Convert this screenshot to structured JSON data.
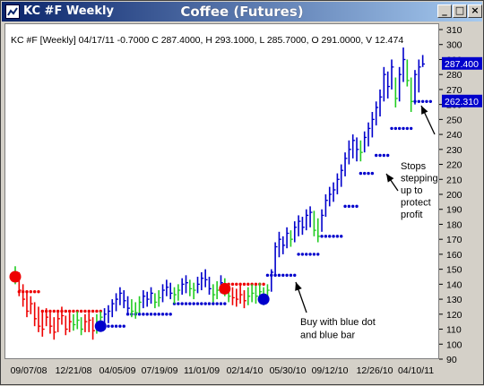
{
  "window": {
    "title_left": "KC #F Weekly",
    "title_center": "Coffee (Futures)",
    "buttons": {
      "minimize": "_",
      "maximize": "□",
      "close": "×"
    }
  },
  "chart_data": {
    "type": "ohlc",
    "info_line": "KC #F [Weekly] 04/17/11  -0.7000 C 287.4000, H 293.1000, L 285.7000, O 291.0000, V 12.474",
    "ylim": [
      90,
      310
    ],
    "y_ticks": [
      90,
      100,
      110,
      120,
      130,
      140,
      150,
      160,
      170,
      180,
      190,
      200,
      210,
      220,
      230,
      240,
      250,
      260,
      270,
      280,
      290,
      300,
      310
    ],
    "x_tick_labels": [
      "09/07/08",
      "12/21/08",
      "04/05/09",
      "07/19/09",
      "11/01/09",
      "02/14/10",
      "05/30/10",
      "09/12/10",
      "12/26/10",
      "04/10/11"
    ],
    "last_price_label": "287.400",
    "stop_price_label": "262.310",
    "colors": {
      "up": "#0000cc",
      "down": "#ee0000",
      "neutral": "#22cc22",
      "badge": "#0000cc"
    },
    "bars": [
      {
        "h": 152,
        "l": 140,
        "c": 143,
        "t": "n"
      },
      {
        "h": 148,
        "l": 132,
        "c": 136,
        "t": "d"
      },
      {
        "h": 140,
        "l": 125,
        "c": 130,
        "t": "d"
      },
      {
        "h": 135,
        "l": 118,
        "c": 122,
        "t": "d"
      },
      {
        "h": 132,
        "l": 120,
        "c": 127,
        "t": "d"
      },
      {
        "h": 128,
        "l": 112,
        "c": 117,
        "t": "d"
      },
      {
        "h": 125,
        "l": 108,
        "c": 112,
        "t": "d"
      },
      {
        "h": 122,
        "l": 105,
        "c": 110,
        "t": "d"
      },
      {
        "h": 124,
        "l": 112,
        "c": 118,
        "t": "d"
      },
      {
        "h": 121,
        "l": 107,
        "c": 112,
        "t": "d"
      },
      {
        "h": 118,
        "l": 103,
        "c": 108,
        "t": "d"
      },
      {
        "h": 122,
        "l": 108,
        "c": 117,
        "t": "d"
      },
      {
        "h": 125,
        "l": 113,
        "c": 119,
        "t": "d"
      },
      {
        "h": 119,
        "l": 106,
        "c": 110,
        "t": "d"
      },
      {
        "h": 121,
        "l": 108,
        "c": 115,
        "t": "d"
      },
      {
        "h": 120,
        "l": 109,
        "c": 113,
        "t": "n"
      },
      {
        "h": 122,
        "l": 110,
        "c": 116,
        "t": "n"
      },
      {
        "h": 118,
        "l": 106,
        "c": 110,
        "t": "n"
      },
      {
        "h": 120,
        "l": 108,
        "c": 115,
        "t": "d"
      },
      {
        "h": 121,
        "l": 108,
        "c": 116,
        "t": "d"
      },
      {
        "h": 118,
        "l": 103,
        "c": 109,
        "t": "d"
      },
      {
        "h": 120,
        "l": 107,
        "c": 115,
        "t": "n"
      },
      {
        "h": 122,
        "l": 110,
        "c": 118,
        "t": "n"
      },
      {
        "h": 124,
        "l": 112,
        "c": 120,
        "t": "u"
      },
      {
        "h": 126,
        "l": 114,
        "c": 122,
        "t": "u"
      },
      {
        "h": 130,
        "l": 118,
        "c": 127,
        "t": "u"
      },
      {
        "h": 134,
        "l": 122,
        "c": 130,
        "t": "u"
      },
      {
        "h": 138,
        "l": 126,
        "c": 134,
        "t": "u"
      },
      {
        "h": 136,
        "l": 124,
        "c": 129,
        "t": "u"
      },
      {
        "h": 132,
        "l": 120,
        "c": 124,
        "t": "u"
      },
      {
        "h": 130,
        "l": 118,
        "c": 122,
        "t": "n"
      },
      {
        "h": 128,
        "l": 117,
        "c": 121,
        "t": "n"
      },
      {
        "h": 132,
        "l": 121,
        "c": 128,
        "t": "n"
      },
      {
        "h": 136,
        "l": 124,
        "c": 132,
        "t": "u"
      },
      {
        "h": 135,
        "l": 125,
        "c": 130,
        "t": "u"
      },
      {
        "h": 138,
        "l": 127,
        "c": 134,
        "t": "u"
      },
      {
        "h": 134,
        "l": 124,
        "c": 128,
        "t": "n"
      },
      {
        "h": 136,
        "l": 125,
        "c": 131,
        "t": "n"
      },
      {
        "h": 140,
        "l": 128,
        "c": 136,
        "t": "u"
      },
      {
        "h": 143,
        "l": 132,
        "c": 138,
        "t": "u"
      },
      {
        "h": 141,
        "l": 130,
        "c": 134,
        "t": "u"
      },
      {
        "h": 138,
        "l": 127,
        "c": 133,
        "t": "n"
      },
      {
        "h": 140,
        "l": 129,
        "c": 136,
        "t": "n"
      },
      {
        "h": 144,
        "l": 133,
        "c": 140,
        "t": "u"
      },
      {
        "h": 146,
        "l": 134,
        "c": 141,
        "t": "u"
      },
      {
        "h": 143,
        "l": 132,
        "c": 137,
        "t": "n"
      },
      {
        "h": 141,
        "l": 130,
        "c": 136,
        "t": "n"
      },
      {
        "h": 145,
        "l": 134,
        "c": 140,
        "t": "u"
      },
      {
        "h": 148,
        "l": 136,
        "c": 144,
        "t": "u"
      },
      {
        "h": 150,
        "l": 138,
        "c": 143,
        "t": "u"
      },
      {
        "h": 145,
        "l": 133,
        "c": 137,
        "t": "u"
      },
      {
        "h": 140,
        "l": 128,
        "c": 133,
        "t": "n"
      },
      {
        "h": 142,
        "l": 130,
        "c": 136,
        "t": "n"
      },
      {
        "h": 146,
        "l": 134,
        "c": 141,
        "t": "u"
      },
      {
        "h": 144,
        "l": 132,
        "c": 137,
        "t": "n"
      },
      {
        "h": 140,
        "l": 128,
        "c": 132,
        "t": "n"
      },
      {
        "h": 138,
        "l": 126,
        "c": 131,
        "t": "d"
      },
      {
        "h": 137,
        "l": 125,
        "c": 130,
        "t": "d"
      },
      {
        "h": 139,
        "l": 127,
        "c": 133,
        "t": "d"
      },
      {
        "h": 136,
        "l": 124,
        "c": 129,
        "t": "d"
      },
      {
        "h": 138,
        "l": 126,
        "c": 132,
        "t": "n"
      },
      {
        "h": 140,
        "l": 128,
        "c": 134,
        "t": "n"
      },
      {
        "h": 139,
        "l": 127,
        "c": 132,
        "t": "n"
      },
      {
        "h": 141,
        "l": 129,
        "c": 135,
        "t": "n"
      },
      {
        "h": 138,
        "l": 126,
        "c": 131,
        "t": "n"
      },
      {
        "h": 140,
        "l": 130,
        "c": 136,
        "t": "n"
      },
      {
        "h": 150,
        "l": 135,
        "c": 148,
        "t": "u"
      },
      {
        "h": 168,
        "l": 146,
        "c": 165,
        "t": "u"
      },
      {
        "h": 175,
        "l": 158,
        "c": 170,
        "t": "u"
      },
      {
        "h": 172,
        "l": 160,
        "c": 166,
        "t": "u"
      },
      {
        "h": 178,
        "l": 164,
        "c": 174,
        "t": "u"
      },
      {
        "h": 176,
        "l": 165,
        "c": 170,
        "t": "n"
      },
      {
        "h": 182,
        "l": 168,
        "c": 178,
        "t": "u"
      },
      {
        "h": 186,
        "l": 172,
        "c": 182,
        "t": "u"
      },
      {
        "h": 185,
        "l": 173,
        "c": 178,
        "t": "u"
      },
      {
        "h": 190,
        "l": 176,
        "c": 186,
        "t": "u"
      },
      {
        "h": 192,
        "l": 178,
        "c": 188,
        "t": "u"
      },
      {
        "h": 189,
        "l": 172,
        "c": 176,
        "t": "n"
      },
      {
        "h": 184,
        "l": 168,
        "c": 172,
        "t": "n"
      },
      {
        "h": 190,
        "l": 175,
        "c": 186,
        "t": "u"
      },
      {
        "h": 200,
        "l": 185,
        "c": 196,
        "t": "u"
      },
      {
        "h": 205,
        "l": 192,
        "c": 200,
        "t": "u"
      },
      {
        "h": 208,
        "l": 195,
        "c": 203,
        "t": "u"
      },
      {
        "h": 214,
        "l": 200,
        "c": 210,
        "t": "u"
      },
      {
        "h": 220,
        "l": 205,
        "c": 216,
        "t": "u"
      },
      {
        "h": 228,
        "l": 212,
        "c": 224,
        "t": "u"
      },
      {
        "h": 236,
        "l": 220,
        "c": 230,
        "t": "u"
      },
      {
        "h": 240,
        "l": 224,
        "c": 236,
        "t": "u"
      },
      {
        "h": 238,
        "l": 222,
        "c": 230,
        "t": "u"
      },
      {
        "h": 236,
        "l": 222,
        "c": 228,
        "t": "n"
      },
      {
        "h": 242,
        "l": 228,
        "c": 238,
        "t": "u"
      },
      {
        "h": 248,
        "l": 232,
        "c": 244,
        "t": "u"
      },
      {
        "h": 255,
        "l": 238,
        "c": 250,
        "t": "u"
      },
      {
        "h": 262,
        "l": 246,
        "c": 258,
        "t": "u"
      },
      {
        "h": 270,
        "l": 252,
        "c": 265,
        "t": "u"
      },
      {
        "h": 285,
        "l": 262,
        "c": 280,
        "t": "u"
      },
      {
        "h": 282,
        "l": 264,
        "c": 272,
        "t": "u"
      },
      {
        "h": 290,
        "l": 270,
        "c": 285,
        "t": "u"
      },
      {
        "h": 278,
        "l": 258,
        "c": 264,
        "t": "n"
      },
      {
        "h": 285,
        "l": 262,
        "c": 280,
        "t": "u"
      },
      {
        "h": 298,
        "l": 275,
        "c": 290,
        "t": "u"
      },
      {
        "h": 290,
        "l": 272,
        "c": 276,
        "t": "n"
      },
      {
        "h": 278,
        "l": 255,
        "c": 262,
        "t": "n"
      },
      {
        "h": 283,
        "l": 260,
        "c": 280,
        "t": "u"
      },
      {
        "h": 290,
        "l": 268,
        "c": 285,
        "t": "u"
      },
      {
        "h": 293,
        "l": 285,
        "c": 287,
        "t": "u"
      }
    ],
    "stop_segments": [
      {
        "start": 1,
        "end": 6,
        "value": 135,
        "color": "#ee0000"
      },
      {
        "start": 7,
        "end": 22,
        "value": 122,
        "color": "#ee0000"
      },
      {
        "start": 23,
        "end": 28,
        "value": 112,
        "color": "#0000cc"
      },
      {
        "start": 29,
        "end": 40,
        "value": 120,
        "color": "#0000cc"
      },
      {
        "start": 41,
        "end": 54,
        "value": 127,
        "color": "#0000cc"
      },
      {
        "start": 55,
        "end": 64,
        "value": 140,
        "color": "#ee0000"
      },
      {
        "start": 65,
        "end": 72,
        "value": 146,
        "color": "#0000cc"
      },
      {
        "start": 73,
        "end": 78,
        "value": 160,
        "color": "#0000cc"
      },
      {
        "start": 79,
        "end": 84,
        "value": 172,
        "color": "#0000cc"
      },
      {
        "start": 85,
        "end": 88,
        "value": 192,
        "color": "#0000cc"
      },
      {
        "start": 89,
        "end": 92,
        "value": 214,
        "color": "#0000cc"
      },
      {
        "start": 93,
        "end": 96,
        "value": 226,
        "color": "#0000cc"
      },
      {
        "start": 97,
        "end": 102,
        "value": 244,
        "color": "#0000cc"
      },
      {
        "start": 103,
        "end": 107,
        "value": 262,
        "color": "#0000cc"
      }
    ],
    "signals": [
      {
        "bar": 0,
        "value": 145,
        "color": "#ee0000"
      },
      {
        "bar": 22,
        "value": 112,
        "color": "#0000cc"
      },
      {
        "bar": 54,
        "value": 137,
        "color": "#ee0000"
      },
      {
        "bar": 64,
        "value": 130,
        "color": "#0000cc"
      }
    ],
    "annotations": {
      "stops_text": [
        "Stops",
        "stepping",
        "up to",
        "protect",
        "profit"
      ],
      "buy_text": [
        "Buy with blue dot",
        "and blue bar"
      ]
    }
  }
}
